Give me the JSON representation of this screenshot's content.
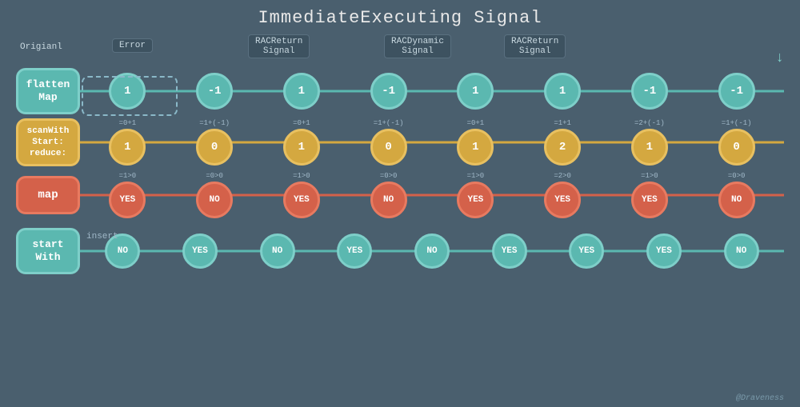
{
  "title": "ImmediateExecuting Signal",
  "headers": {
    "original": "Origianl",
    "error": "Error",
    "racReturn1": "RACReturn\nSignal",
    "racDynamic": "RACDynamic\nSignal",
    "racReturn2": "RACReturn\nSignal"
  },
  "rows": {
    "flattenMap": {
      "label": "flatten\nMap",
      "color": "teal",
      "nodes": [
        "1",
        "-1",
        "1",
        "-1",
        "1",
        "1",
        "-1",
        "-1"
      ],
      "equations": [
        "",
        "",
        "",
        "",
        "",
        "",
        "",
        ""
      ]
    },
    "scanWith": {
      "label": "scanWith\nStart:\nreduce:",
      "color": "yellow",
      "nodes": [
        "1",
        "0",
        "1",
        "0",
        "1",
        "2",
        "1",
        "0"
      ],
      "equations": [
        "=0+1",
        "=1+(-1)",
        "=0+1",
        "=1+(-1)",
        "=0+1",
        "=1+1",
        "=2+(-1)",
        "=1+(-1)"
      ]
    },
    "map": {
      "label": "map",
      "color": "red",
      "nodes": [
        "YES",
        "NO",
        "YES",
        "NO",
        "YES",
        "YES",
        "YES",
        "NO"
      ],
      "equations": [
        "=1>0",
        "=0>0",
        "=1>0",
        "=0>0",
        "=1>0",
        "=2>0",
        "=1>0",
        "=0>0"
      ]
    },
    "startWith": {
      "label": "start\nWith",
      "color": "teal",
      "nodes": [
        "NO",
        "YES",
        "NO",
        "YES",
        "NO",
        "YES",
        "YES",
        "YES",
        "NO"
      ],
      "equations": [
        "",
        "",
        "",
        "",
        "",
        "",
        "",
        "",
        ""
      ],
      "insertLabel": "insert"
    }
  },
  "watermark": "@Draveness"
}
